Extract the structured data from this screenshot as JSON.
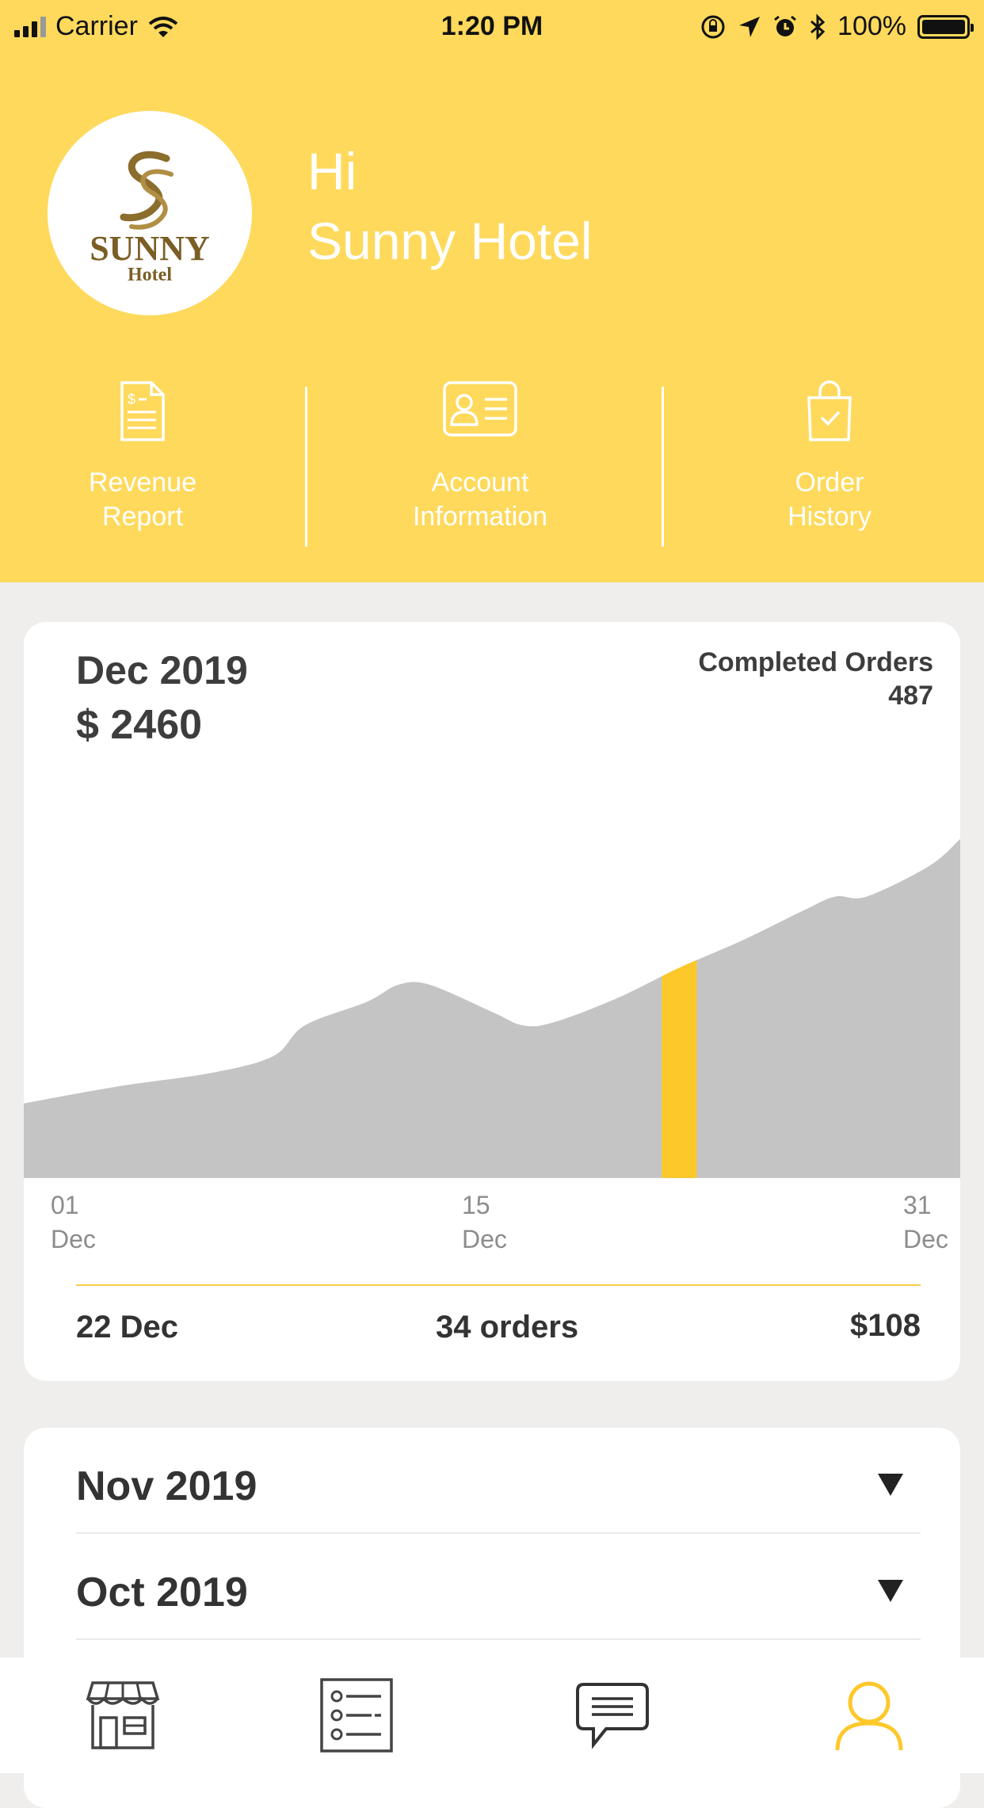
{
  "status_bar": {
    "carrier": "Carrier",
    "time": "1:20 PM",
    "battery": "100%"
  },
  "header": {
    "logo_text": "SUNNY",
    "logo_subtext": "Hotel",
    "greeting_line1": "Hi",
    "greeting_line2": "Sunny Hotel",
    "accent_color": "#fed95c"
  },
  "quick_actions": [
    {
      "line1": "Revenue",
      "line2": "Report",
      "icon": "revenue-report-icon"
    },
    {
      "line1": "Account",
      "line2": "Information",
      "icon": "id-card-icon"
    },
    {
      "line1": "Order",
      "line2": "History",
      "icon": "shopping-bag-icon"
    }
  ],
  "current_month": {
    "month": "Dec 2019",
    "revenue": "$ 2460",
    "completed_label": "Completed Orders",
    "completed_count": "487",
    "summary": {
      "date": "22 Dec",
      "orders": "34 orders",
      "amount": "$108"
    }
  },
  "chart_data": {
    "type": "area",
    "x_ticks": [
      {
        "day": "01",
        "month": "Dec"
      },
      {
        "day": "15",
        "month": "Dec"
      },
      {
        "day": "31",
        "month": "Dec"
      }
    ],
    "x_range": [
      1,
      31
    ],
    "highlight_day": 22,
    "fill_color": "#c4c4c4",
    "highlight_color": "#fdc82a",
    "series": [
      {
        "x": 1,
        "y": 22
      },
      {
        "x": 4,
        "y": 27
      },
      {
        "x": 7,
        "y": 31
      },
      {
        "x": 9,
        "y": 36
      },
      {
        "x": 10,
        "y": 45
      },
      {
        "x": 12,
        "y": 52
      },
      {
        "x": 13,
        "y": 57
      },
      {
        "x": 14,
        "y": 57
      },
      {
        "x": 16,
        "y": 49
      },
      {
        "x": 17,
        "y": 45
      },
      {
        "x": 18,
        "y": 46
      },
      {
        "x": 20,
        "y": 53
      },
      {
        "x": 22,
        "y": 62
      },
      {
        "x": 24,
        "y": 70
      },
      {
        "x": 26,
        "y": 79
      },
      {
        "x": 27,
        "y": 83
      },
      {
        "x": 28,
        "y": 83
      },
      {
        "x": 30,
        "y": 92
      },
      {
        "x": 31,
        "y": 100
      }
    ]
  },
  "past_months": [
    {
      "label": "Nov 2019"
    },
    {
      "label": "Oct 2019"
    }
  ],
  "tab_bar": [
    {
      "name": "store-icon",
      "active": false
    },
    {
      "name": "list-icon",
      "active": false
    },
    {
      "name": "chat-icon",
      "active": false
    },
    {
      "name": "profile-icon",
      "active": true
    }
  ]
}
